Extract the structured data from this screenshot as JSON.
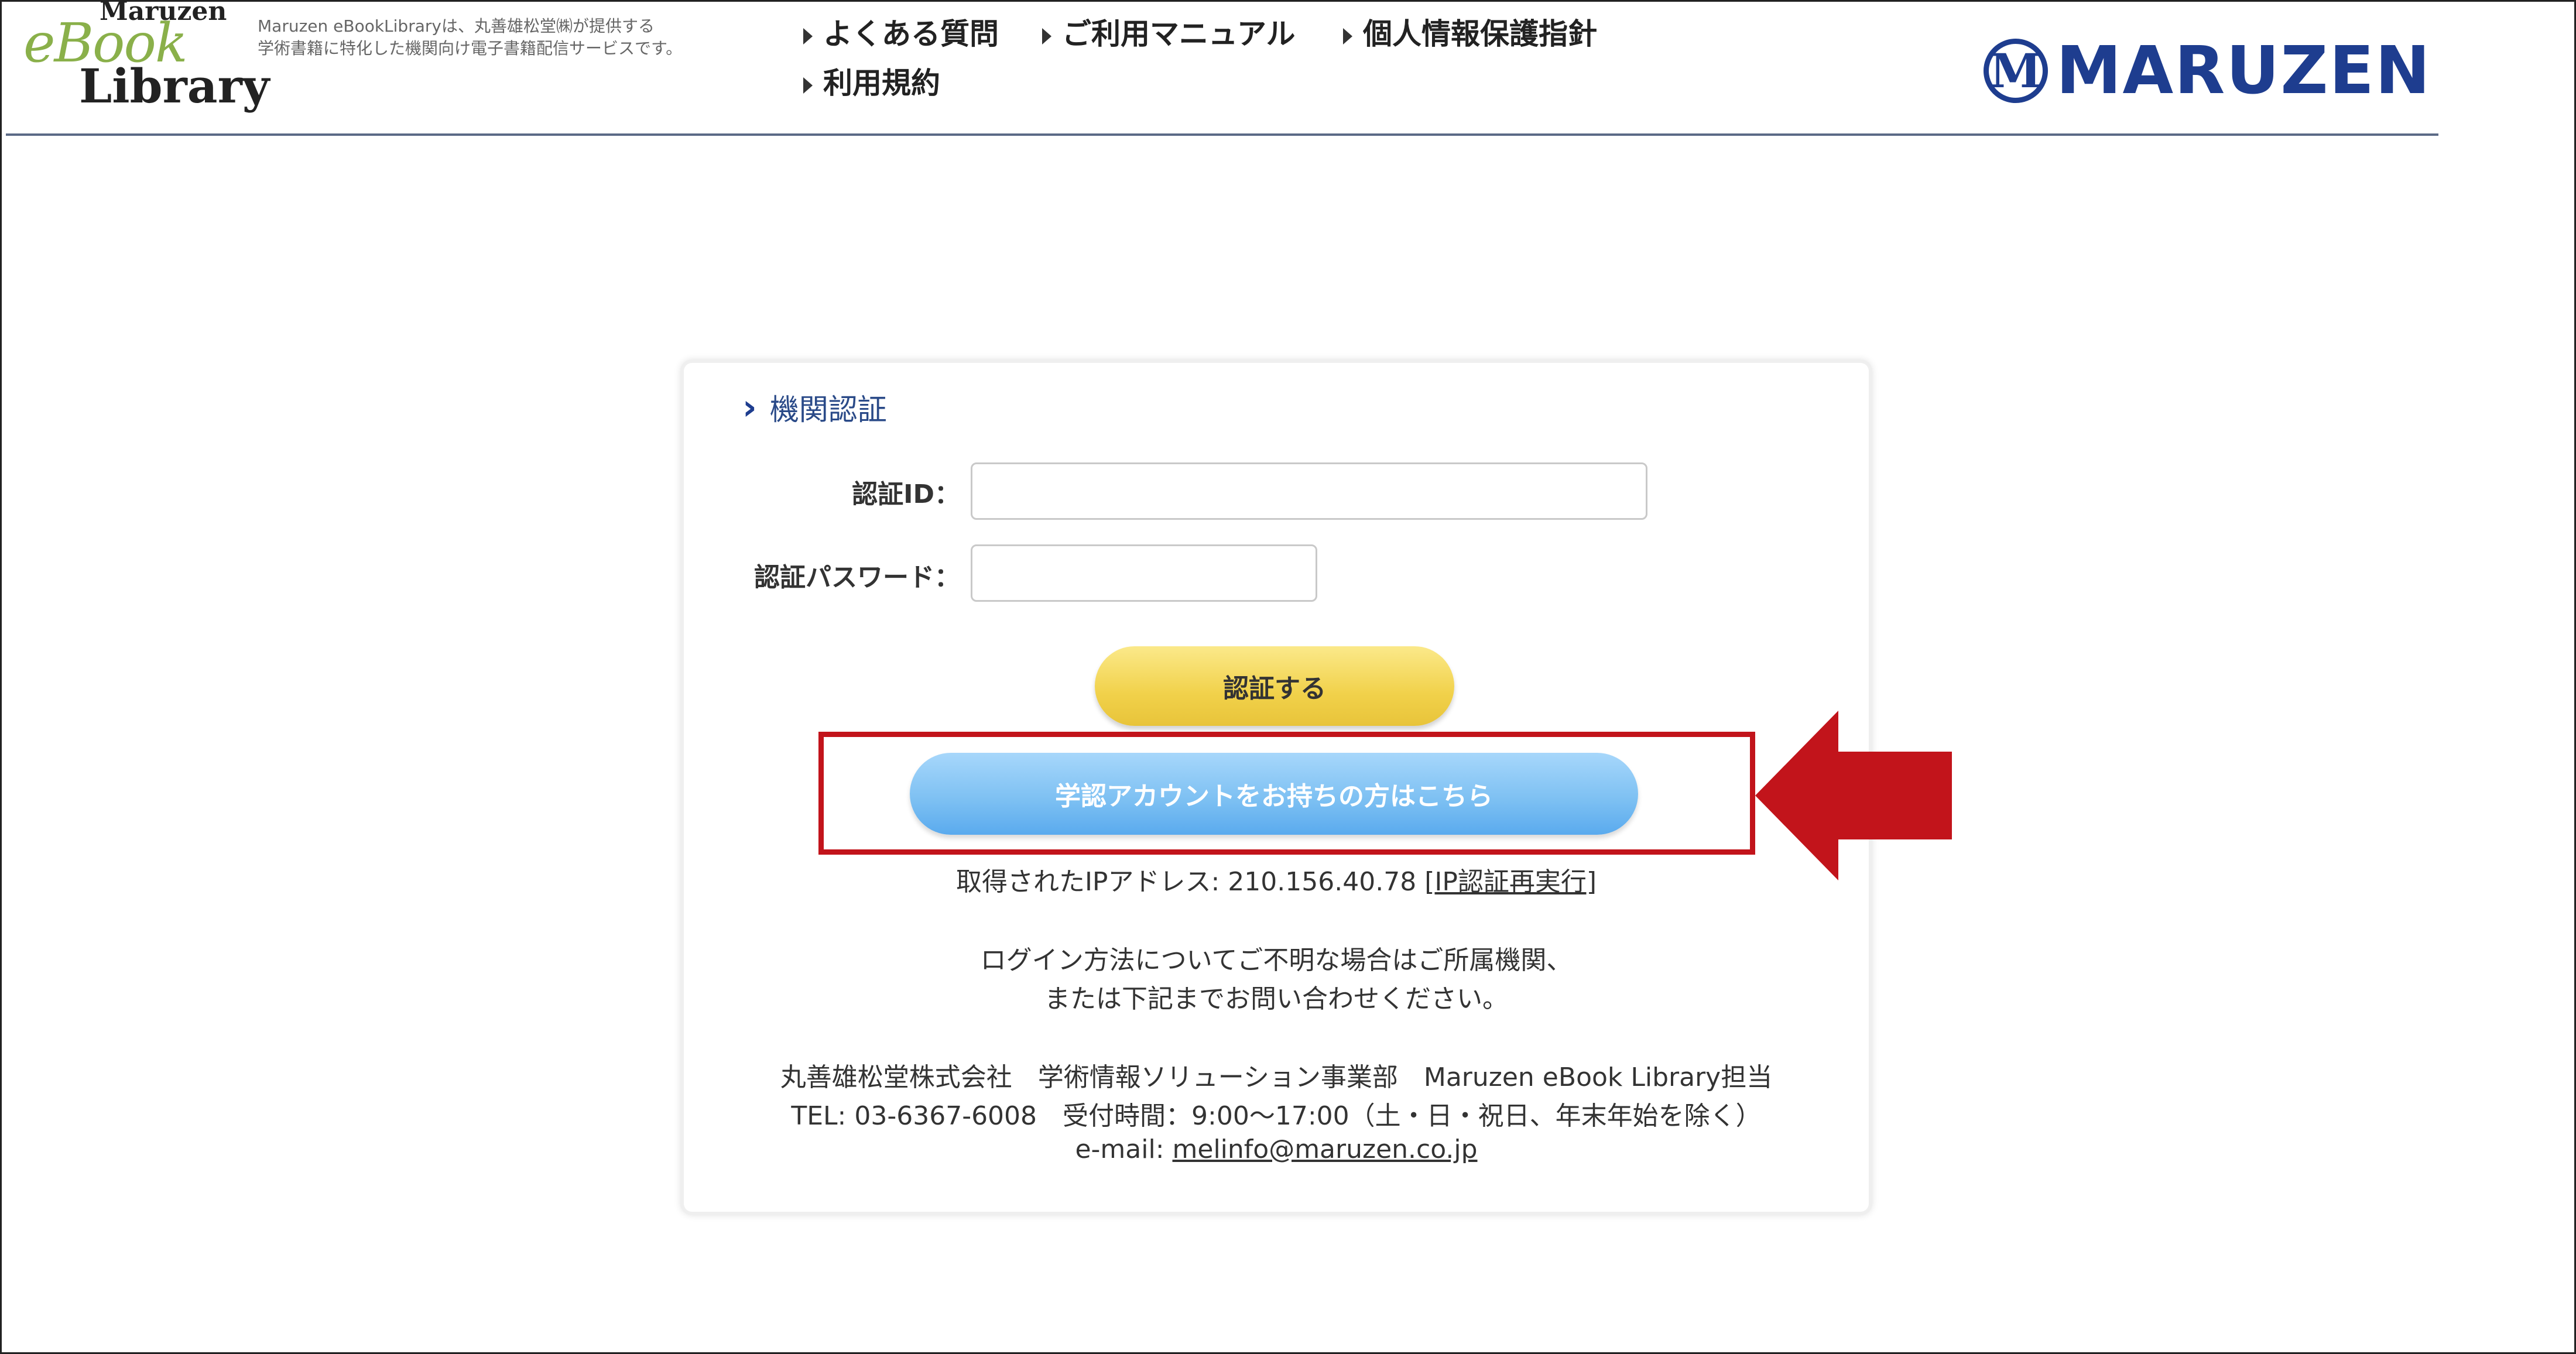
{
  "header": {
    "logo": {
      "line1": "Maruzen",
      "line2": "eBook",
      "line3": "Library"
    },
    "tagline_line1": "Maruzen eBookLibraryは、丸善雄松堂㈱が提供する",
    "tagline_line2": "学術書籍に特化した機関向け電子書籍配信サービスです。",
    "nav": {
      "faq": "よくある質問",
      "manual": "ご利用マニュアル",
      "privacy": "個人情報保護指針",
      "terms": "利用規約"
    },
    "brand_mark": "M",
    "brand_name": "MARUZEN"
  },
  "auth": {
    "section_title": "機関認証",
    "id_label": "認証ID：",
    "id_value": "",
    "password_label": "認証パスワード：",
    "password_value": "",
    "submit_label": "認証する",
    "academic_label": "学認アカウントをお持ちの方はこちら",
    "ip_prefix": "取得されたIPアドレス: ",
    "ip_address": "210.156.40.78",
    "ip_rerun_link": "[IP認証再実行]"
  },
  "help": {
    "line1": "ログイン方法についてご不明な場合はご所属機関、",
    "line2": "または下記までお問い合わせください。"
  },
  "contact": {
    "line1": "丸善雄松堂株式会社　学術情報ソリューション事業部　Maruzen eBook Library担当",
    "line2": "TEL: 03-6367-6008　受付時間：9:00〜17:00（土・日・祝日、年末年始を除く）",
    "email_prefix": "e-mail: ",
    "email": "melinfo@maruzen.co.jp"
  },
  "annotation": {
    "highlight_color": "#c2141b"
  }
}
